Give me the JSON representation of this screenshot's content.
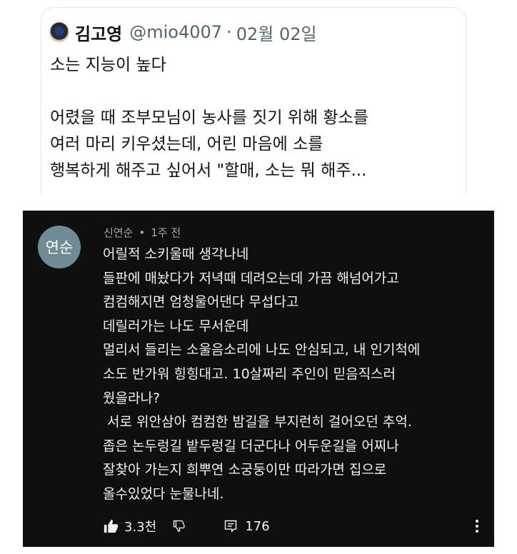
{
  "tweet": {
    "name": "김고영",
    "handle": "@mio4007",
    "dot": "·",
    "date": "02월 02일",
    "lines": [
      "소는 지능이 높다",
      "",
      "어렸을 때 조부모님이 농사를 짓기 위해 황소를",
      "여러 마리 키우셨는데, 어린 마음에 소를",
      "행복하게 해주고 싶어서 \"할매, 소는 뭐 해주..."
    ]
  },
  "comment": {
    "avatar_text": "연순",
    "author": "신연순",
    "dot": "•",
    "time": "1주 전",
    "lines": [
      "어릴적 소키울때 생각나네",
      "들판에 매놨다가 저녁때 데려오는데 가끔 해넘어가고",
      "컴컴해지면 엄청울어댄다 무섭다고",
      "데릴러가는 나도 무서운데",
      "멀리서 들리는 소울음소리에 나도 안심되고, 내 인기척에",
      "소도 반가워 힝힝대고. 10살짜리 주인이 믿음직스러",
      "웠을라나?",
      " 서로 위안삼아 컴컴한 밤길을 부지런히 걸어오던 추억.",
      "좁은 논두렁길 밭두렁길 더군다나 어두운길을 어찌나",
      "잘찾아 가는지 희뿌연 소궁둥이만 따라가면 집으로",
      "올수있었다 눈물나네."
    ],
    "likes": "3.3천",
    "replies": "176"
  },
  "icons": {
    "like": "thumbs-up-icon",
    "dislike": "thumbs-down-icon",
    "reply": "comment-icon",
    "more": "more-vertical-icon"
  },
  "colors": {
    "tweet_text": "#0f1419",
    "tweet_secondary": "#536471",
    "comment_bg": "#0f0f0f",
    "comment_meta": "#aaaaaa",
    "comment_avatar": "#6f8c95"
  }
}
